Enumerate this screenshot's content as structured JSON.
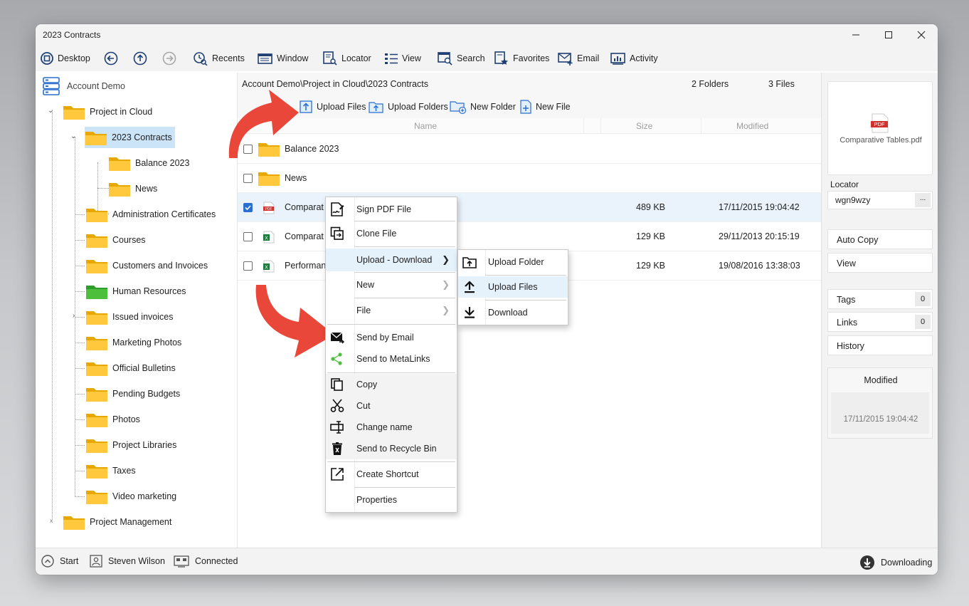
{
  "window": {
    "title": "2023 Contracts"
  },
  "toolbar": {
    "desktop": "Desktop",
    "recents": "Recents",
    "window": "Window",
    "locator": "Locator",
    "view": "View",
    "search": "Search",
    "favorites": "Favorites",
    "email": "Email",
    "activity": "Activity"
  },
  "tree": {
    "root": "Account Demo",
    "project_in_cloud": "Project in Cloud",
    "contracts_2023": "2023 Contracts",
    "balance_2023": "Balance 2023",
    "news": "News",
    "children": [
      "Administration Certificates",
      "Courses",
      "Customers and Invoices",
      "Human Resources",
      "Issued invoices",
      "Marketing Photos",
      "Official Bulletins",
      "Pending Budgets",
      "Photos",
      "Project Libraries",
      "Taxes",
      "Video marketing"
    ],
    "project_management": "Project Management"
  },
  "main": {
    "path": "Account Demo\\Project in Cloud\\2023 Contracts",
    "folders_count": "2 Folders",
    "files_count": "3 Files",
    "actions": {
      "upload_files": "Upload Files",
      "upload_folders": "Upload Folders",
      "new_folder": "New Folder",
      "new_file": "New File"
    },
    "columns": {
      "name": "Name",
      "size": "Size",
      "modified": "Modified"
    },
    "rows": [
      {
        "name": "Balance 2023",
        "size": "",
        "modified": "",
        "checked": false
      },
      {
        "name": "News",
        "size": "",
        "modified": "",
        "checked": false
      },
      {
        "name": "Comparat",
        "size": "489 KB",
        "modified": "17/11/2015 19:04:42",
        "checked": true
      },
      {
        "name": "Comparat",
        "size": "129 KB",
        "modified": "29/11/2013 20:15:19",
        "checked": false
      },
      {
        "name": "Performan",
        "size": "129 KB",
        "modified": "19/08/2016 13:38:03",
        "checked": false
      }
    ]
  },
  "context_menu": {
    "items": [
      "Sign PDF File",
      "Clone File",
      "Upload - Download",
      "New",
      "File",
      "Send by Email",
      "Send to MetaLinks",
      "Copy",
      "Cut",
      "Change name",
      "Send to Recycle Bin",
      "Create Shortcut",
      "Properties"
    ],
    "submenu": [
      "Upload Folder",
      "Upload Files",
      "Download"
    ]
  },
  "right_panel": {
    "preview_file": "Comparative Tables.pdf",
    "pdf_badge": "PDF",
    "locator_label": "Locator",
    "locator_value": "wgn9wzy",
    "more_button": "...",
    "auto_copy": "Auto Copy",
    "view": "View",
    "tags_label": "Tags",
    "tags_count": "0",
    "links_label": "Links",
    "links_count": "0",
    "history": "History",
    "modified_label": "Modified",
    "modified_value": "17/11/2015 19:04:42"
  },
  "status": {
    "start": "Start",
    "user": "Steven Wilson",
    "connection": "Connected",
    "transfer": "Downloading"
  },
  "file_badges": {
    "pdf": "PDF",
    "excel": "X"
  },
  "colors": {
    "accent": "#2a6fd0",
    "selection": "#cce4f7",
    "folder_yellow": "#ffc83d",
    "folder_green": "#4cbf3c",
    "callout_red": "#e8473a"
  }
}
